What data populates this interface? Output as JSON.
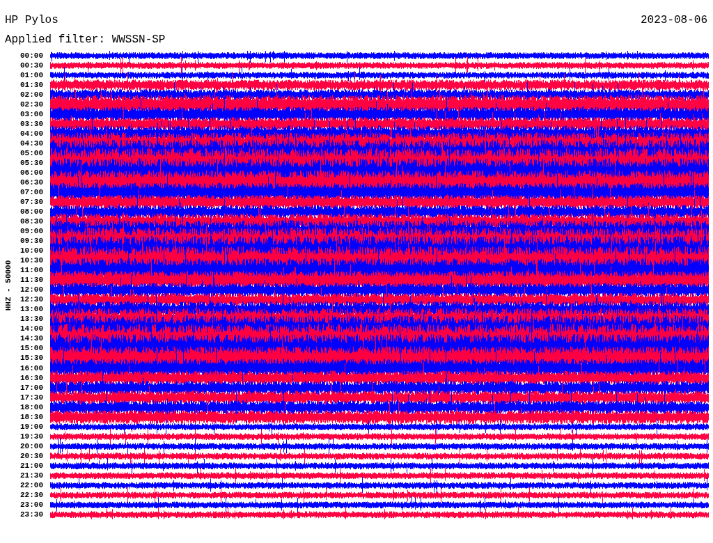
{
  "header": {
    "station": "HP Pylos",
    "date": "2023-08-06",
    "filter": "Applied filter: WWSSN-SP"
  },
  "channel_label": "HHZ - 50000",
  "time_labels": [
    "00:00",
    "00:30",
    "01:00",
    "01:30",
    "02:00",
    "02:30",
    "03:00",
    "03:30",
    "04:00",
    "04:30",
    "05:00",
    "05:30",
    "06:00",
    "06:30",
    "07:00",
    "07:30",
    "08:00",
    "08:30",
    "09:00",
    "09:30",
    "10:00",
    "10:30",
    "11:00",
    "11:30",
    "12:00",
    "12:30",
    "13:00",
    "13:30",
    "14:00",
    "14:30",
    "15:00",
    "15:30",
    "16:00",
    "16:30",
    "17:00",
    "17:30",
    "18:00",
    "18:30",
    "19:00",
    "19:30",
    "20:00",
    "20:30",
    "21:00",
    "21:30",
    "22:00",
    "22:30",
    "23:00",
    "23:30"
  ]
}
